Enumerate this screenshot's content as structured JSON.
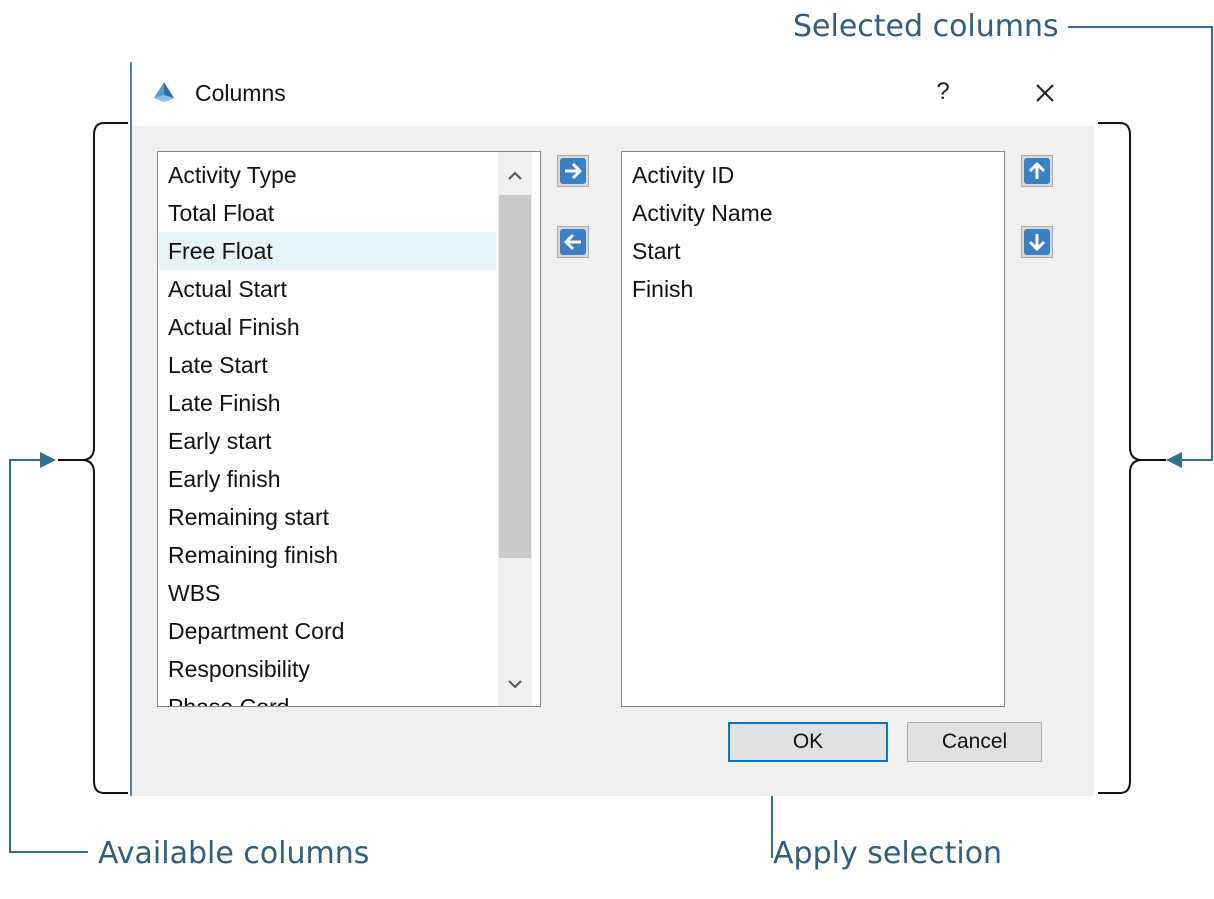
{
  "annotations": {
    "selected_columns": "Selected columns",
    "available_columns": "Available columns",
    "apply_selection": "Apply selection",
    "accent_color": "#2f6f8f"
  },
  "dialog": {
    "title": "Columns",
    "app_icon": "cone-icon",
    "help_label": "?",
    "close_icon": "close-icon",
    "available_list": {
      "items": [
        "Activity Type",
        "Total Float",
        "Free Float",
        "Actual Start",
        "Actual Finish",
        "Late Start",
        "Late Finish",
        "Early start",
        "Early finish",
        "Remaining start",
        "Remaining finish",
        "WBS",
        "Department Cord",
        "Responsibility",
        "Phase Cord"
      ],
      "selected_index": 2
    },
    "selected_list": {
      "items": [
        "Activity ID",
        "Activity Name",
        "Start",
        "Finish"
      ]
    },
    "buttons": {
      "add_icon": "arrow-right-icon",
      "remove_icon": "arrow-left-icon",
      "move_up_icon": "arrow-up-icon",
      "move_down_icon": "arrow-down-icon",
      "ok_label": "OK",
      "cancel_label": "Cancel"
    }
  }
}
